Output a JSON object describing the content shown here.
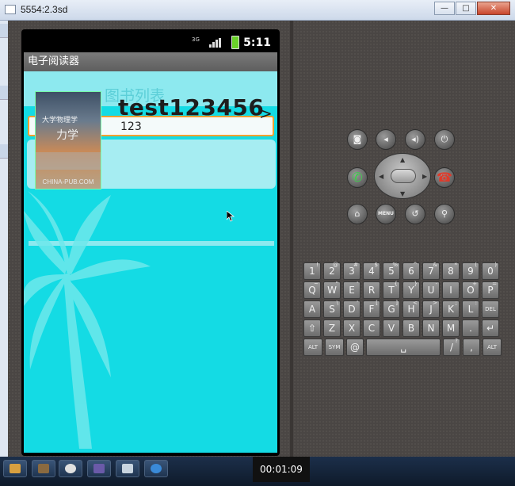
{
  "window": {
    "title": "5554:2.3sd",
    "minimize_glyph": "—",
    "maximize_glyph": "□",
    "close_glyph": "✕"
  },
  "status_bar": {
    "time": "5:11",
    "network": "3G",
    "indicator_icons": [
      "3g-signal-icon",
      "signal-bars-icon",
      "battery-icon"
    ]
  },
  "app": {
    "title": "电子阅读器",
    "heading": "图书列表",
    "search": {
      "value": "",
      "placeholder": ""
    },
    "books": [
      {
        "title": "test123456",
        "subtitle": "123",
        "chevron": ">",
        "cover": {
          "title_line": "大学物理学",
          "main_text": "力学",
          "footer": "CHINA-PUB.COM"
        }
      }
    ]
  },
  "controls": {
    "camera": "camera-icon",
    "volume_down": "volume-down-icon",
    "volume_up": "volume-up-icon",
    "power": "power-icon",
    "call": "call-icon",
    "end_call": "end-call-icon",
    "home": "home-icon",
    "menu_label": "MENU",
    "back": "back-icon",
    "search": "search-icon"
  },
  "keyboard": {
    "rows": [
      [
        {
          "k": "1",
          "a": "!"
        },
        {
          "k": "2",
          "a": "@"
        },
        {
          "k": "3",
          "a": "#"
        },
        {
          "k": "4",
          "a": "$"
        },
        {
          "k": "5",
          "a": "%"
        },
        {
          "k": "6",
          "a": "^"
        },
        {
          "k": "7",
          "a": "&"
        },
        {
          "k": "8",
          "a": "*"
        },
        {
          "k": "9",
          "a": "("
        },
        {
          "k": "0",
          "a": ")"
        }
      ],
      [
        {
          "k": "Q",
          "a": "~"
        },
        {
          "k": "W",
          "a": "\""
        },
        {
          "k": "E",
          "a": "'"
        },
        {
          "k": "R",
          "a": ""
        },
        {
          "k": "T",
          "a": "{"
        },
        {
          "k": "Y",
          "a": "}"
        },
        {
          "k": "U",
          "a": "-"
        },
        {
          "k": "I",
          "a": ""
        },
        {
          "k": "O",
          "a": "+"
        },
        {
          "k": "P",
          "a": "="
        }
      ],
      [
        {
          "k": "A",
          "a": ""
        },
        {
          "k": "S",
          "a": "\\"
        },
        {
          "k": "D",
          "a": "'"
        },
        {
          "k": "F",
          "a": "["
        },
        {
          "k": "G",
          "a": "]"
        },
        {
          "k": "H",
          "a": "<"
        },
        {
          "k": "J",
          "a": ">"
        },
        {
          "k": "K",
          "a": ";"
        },
        {
          "k": "L",
          "a": ":"
        },
        {
          "k": "DEL",
          "a": ""
        }
      ],
      [
        {
          "k": "⇧",
          "a": ""
        },
        {
          "k": "Z",
          "a": ""
        },
        {
          "k": "X",
          "a": ""
        },
        {
          "k": "C",
          "a": ""
        },
        {
          "k": "V",
          "a": ""
        },
        {
          "k": "B",
          "a": ""
        },
        {
          "k": "N",
          "a": ""
        },
        {
          "k": "M",
          "a": ""
        },
        {
          "k": ".",
          "a": ""
        },
        {
          "k": "↵",
          "a": ""
        }
      ],
      [
        {
          "k": "ALT",
          "a": ""
        },
        {
          "k": "SYM",
          "a": ""
        },
        {
          "k": "@",
          "a": ""
        },
        {
          "k": "␣",
          "a": ""
        },
        {
          "k": "/",
          "a": "?"
        },
        {
          "k": ",",
          "a": ""
        },
        {
          "k": "ALT",
          "a": ""
        }
      ]
    ]
  },
  "taskbar": {
    "timer": "00:01:09",
    "item_icons": [
      "start-icon",
      "app1-icon",
      "app2-icon",
      "app3-icon",
      "app4-icon",
      "app5-icon"
    ]
  },
  "colors": {
    "app_bg": "#14dbe4",
    "header_bg": "#8de9ef",
    "search_border": "#f0a030",
    "call": "#3cd04a",
    "end_call": "#e03a2a"
  }
}
